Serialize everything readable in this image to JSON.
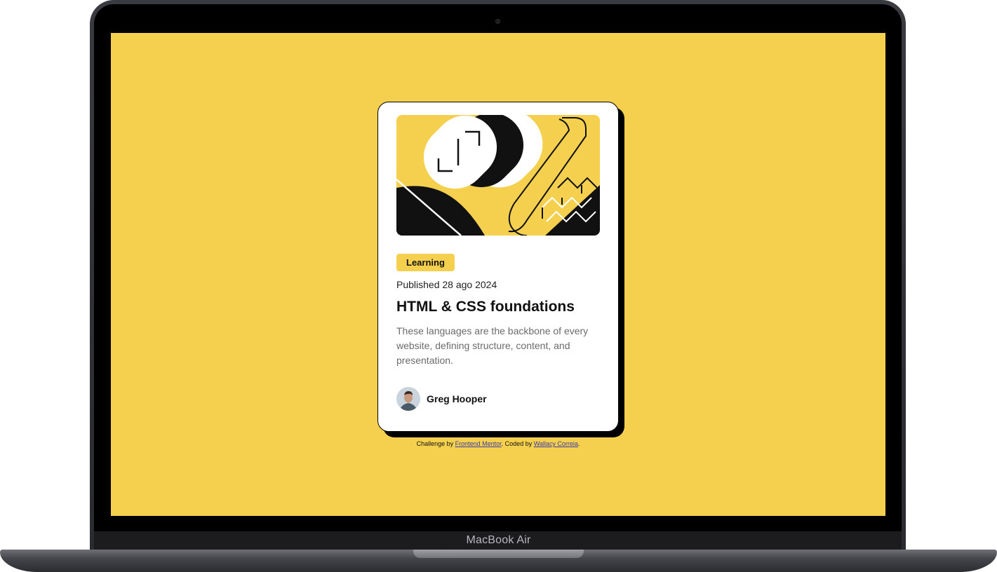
{
  "device": {
    "brand_label": "MacBook Air"
  },
  "colors": {
    "background": "#f4d04e",
    "card": "#ffffff",
    "ink": "#111111",
    "muted": "#6b6b6b",
    "badge": "#f4d04e"
  },
  "card": {
    "illustration_name": "abstract-blog-illustration",
    "category": "Learning",
    "published": "Published 28 ago 2024",
    "title": "HTML & CSS foundations",
    "description": "These languages are the backbone of every website, defining structure, content, and presentation.",
    "author": {
      "name": "Greg Hooper"
    }
  },
  "footer": {
    "prefix": "Challenge by ",
    "challenge_link": "Frontend Mentor",
    "middle": ". Coded by ",
    "coder_link": "Wallacy Correia",
    "suffix": "."
  }
}
